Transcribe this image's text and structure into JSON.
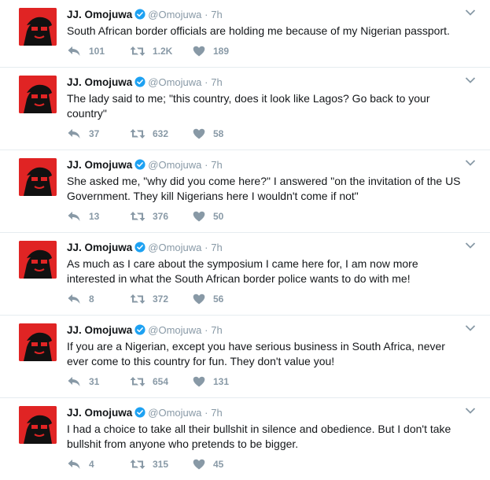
{
  "author": {
    "name": "JJ. Omojuwa",
    "handle": "@Omojuwa",
    "separator": "·"
  },
  "colors": {
    "avatar_bg": "#e02424",
    "verified": "#1da1f2",
    "secondary_text": "#8899a6"
  },
  "icons": {
    "reply": "reply-icon",
    "retweet": "retweet-icon",
    "like": "heart-icon",
    "verified": "verified-badge-icon",
    "more": "chevron-down-icon"
  },
  "tweets": [
    {
      "time": "7h",
      "text": "South African border officials are holding me because of my Nigerian passport.",
      "replies": "101",
      "retweets": "1.2K",
      "likes": "189"
    },
    {
      "time": "7h",
      "text": "The lady said to me; \"this country, does it look like Lagos? Go back to your country\"",
      "replies": "37",
      "retweets": "632",
      "likes": "58"
    },
    {
      "time": "7h",
      "text": "She asked me, \"why did you come here?\" I answered \"on the invitation of the US Government. They kill Nigerians here I wouldn't come if not\"",
      "replies": "13",
      "retweets": "376",
      "likes": "50"
    },
    {
      "time": "7h",
      "text": "As much as I care about the symposium I came here for, I am now more interested in what the South African border police wants to do with me!",
      "replies": "8",
      "retweets": "372",
      "likes": "56"
    },
    {
      "time": "7h",
      "text": "If you are a Nigerian, except you have serious business in South Africa, never ever come to this country for fun. They don't value you!",
      "replies": "31",
      "retweets": "654",
      "likes": "131"
    },
    {
      "time": "7h",
      "text": "I had a choice to take all their bullshit in silence and obedience. But I don't take bullshit from anyone who pretends to be bigger.",
      "replies": "4",
      "retweets": "315",
      "likes": "45"
    }
  ]
}
